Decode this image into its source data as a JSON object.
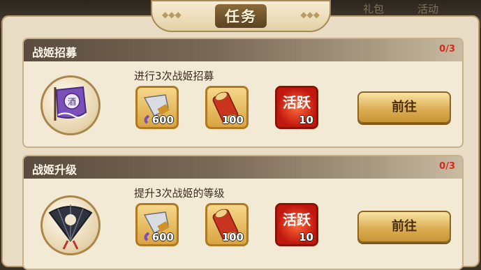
{
  "background": {
    "top_right_text_1": "礼包",
    "top_right_text_2": "活动"
  },
  "header": {
    "title": "任务"
  },
  "tasks": [
    {
      "name": "战姬招募",
      "progress": "0/3",
      "description": "进行3次战姬招募",
      "icon": "purple-banner-icon",
      "rewards": [
        {
          "icon": "silver-horn-icon",
          "count": "600"
        },
        {
          "icon": "scroll-icon",
          "count": "100"
        },
        {
          "icon": "activity-token-icon",
          "count": "10",
          "label": "活跃"
        }
      ],
      "button_label": "前往"
    },
    {
      "name": "战姬升级",
      "progress": "0/3",
      "description": "提升3次战姬的等级",
      "icon": "folding-fan-icon",
      "rewards": [
        {
          "icon": "silver-horn-icon",
          "count": "600"
        },
        {
          "icon": "scroll-icon",
          "count": "100"
        },
        {
          "icon": "activity-token-icon",
          "count": "10",
          "label": "活跃"
        }
      ],
      "button_label": "前往"
    }
  ]
}
